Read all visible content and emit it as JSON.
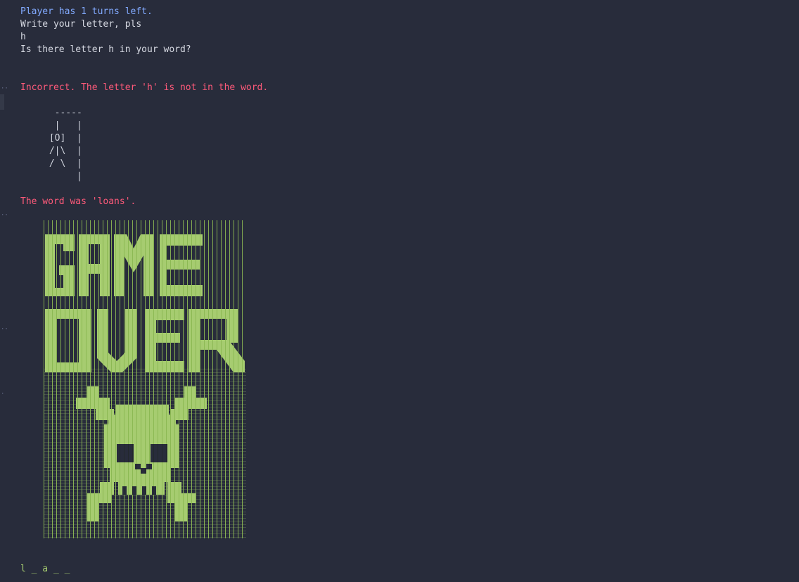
{
  "terminal": {
    "lines": {
      "turns": "Player has 1 turns left.",
      "prompt": "Write your letter, pls",
      "input": "h",
      "question": "Is there letter h in your word?",
      "incorrect": "Incorrect. The letter 'h' is not in the word.",
      "reveal": "The word was 'loans'.",
      "progress": "l _ a _ _"
    },
    "hangman_art": "  -----\n  |   |\n [O]  |\n /|\\  |\n / \\  |\n      |"
  },
  "banner": {
    "lines": [
      "GAME",
      "OVER"
    ]
  },
  "colors": {
    "background": "#282c3b",
    "info": "#82aaff",
    "text": "#d6d9e2",
    "error": "#ff5a7a",
    "art": "#a6cc70"
  }
}
